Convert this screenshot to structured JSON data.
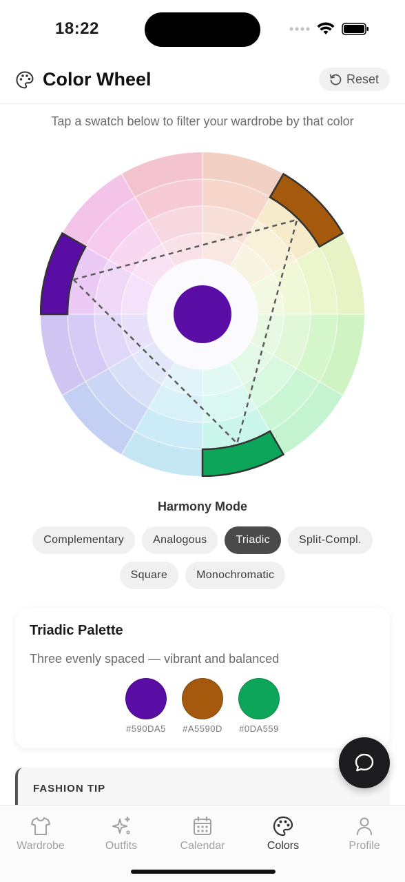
{
  "status": {
    "time": "18:22"
  },
  "header": {
    "title": "Color Wheel",
    "reset_label": "Reset"
  },
  "subtitle": "Tap a swatch below to filter your wardrobe by that color",
  "wheel": {
    "center_color": "#590DA5",
    "selected_colors": [
      "#590DA5",
      "#A5590D",
      "#0DA559"
    ]
  },
  "harmony": {
    "label": "Harmony Mode",
    "modes": [
      "Complementary",
      "Analogous",
      "Triadic",
      "Split-Compl.",
      "Square",
      "Monochromatic"
    ],
    "active": "Triadic"
  },
  "palette": {
    "title": "Triadic Palette",
    "description": "Three evenly spaced — vibrant and balanced",
    "swatches": [
      {
        "color": "#590DA5",
        "hex": "#590DA5"
      },
      {
        "color": "#A5590D",
        "hex": "#A5590D"
      },
      {
        "color": "#0DA559",
        "hex": "#0DA559"
      }
    ]
  },
  "tip": {
    "label": "FASHION TIP"
  },
  "tabs": [
    {
      "label": "Wardrobe",
      "icon": "shirt-icon"
    },
    {
      "label": "Outfits",
      "icon": "sparkles-icon"
    },
    {
      "label": "Calendar",
      "icon": "calendar-icon"
    },
    {
      "label": "Colors",
      "icon": "palette-icon",
      "active": true
    },
    {
      "label": "Profile",
      "icon": "person-icon"
    }
  ]
}
